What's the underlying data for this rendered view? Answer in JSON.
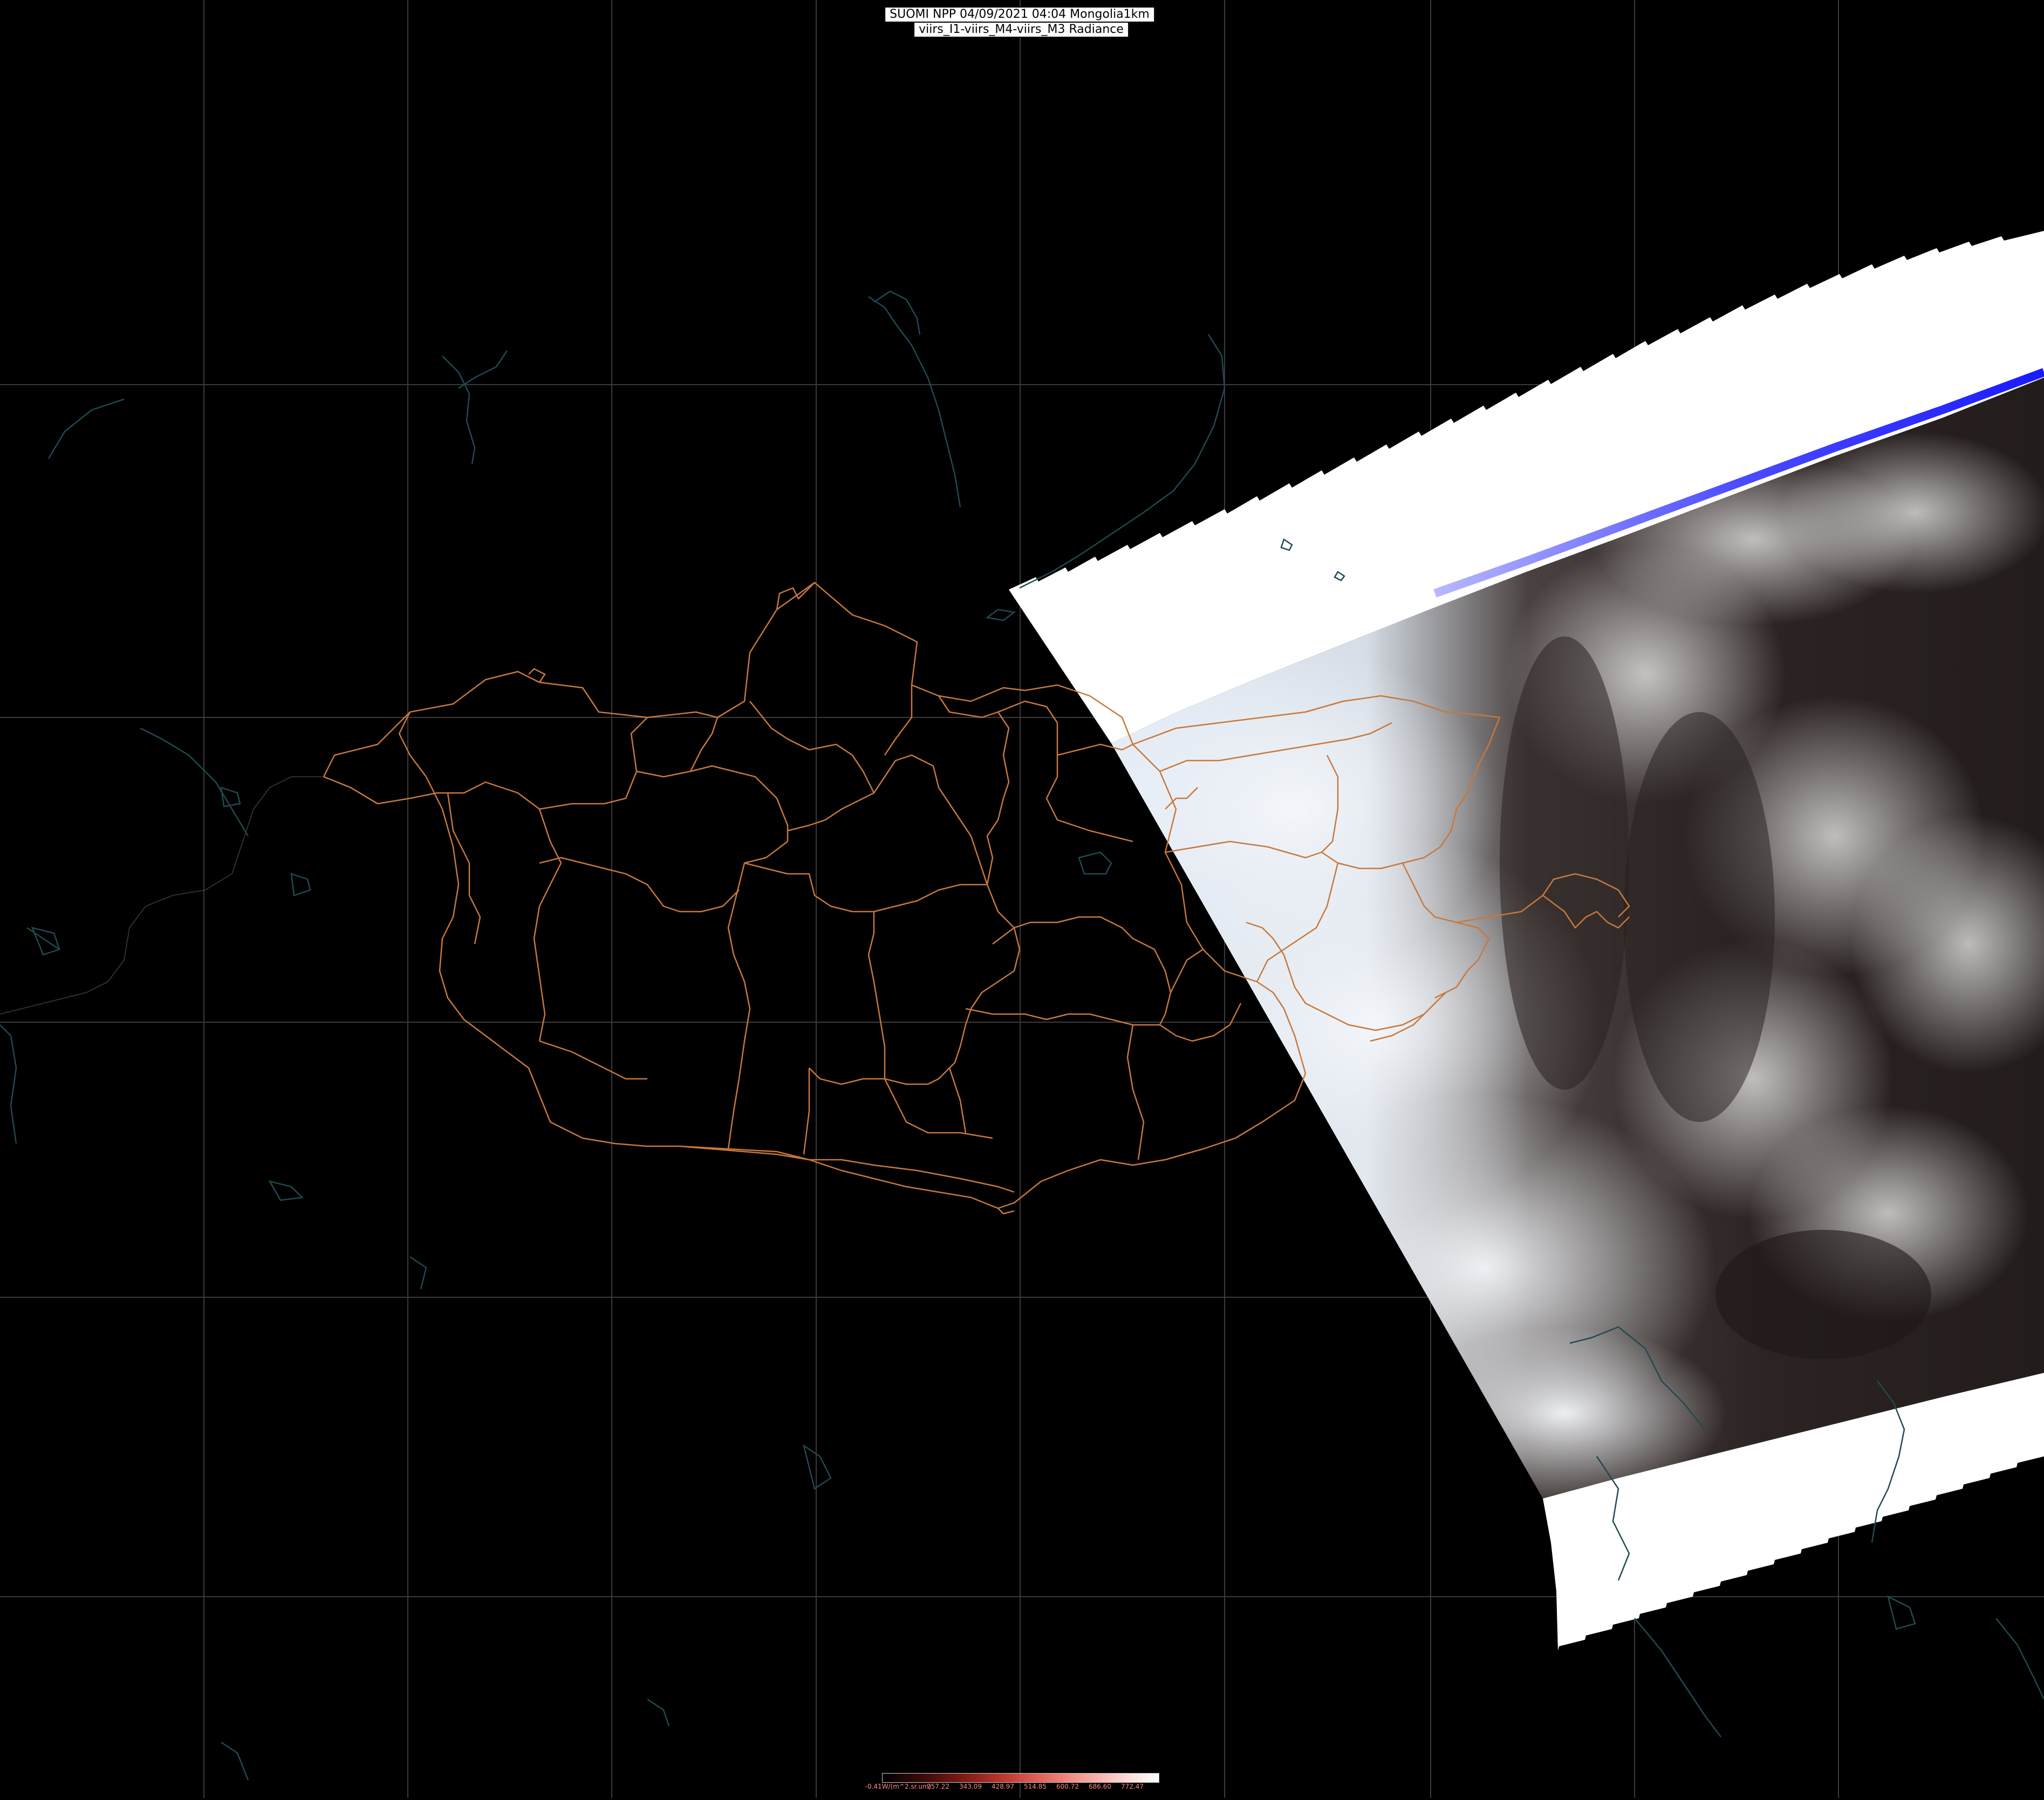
{
  "title": {
    "line1": "SUOMI NPP 04/09/2021 04:04 Mongolia1km",
    "line2": "viirs_I1-viirs_M4-viirs_M3 Radiance"
  },
  "colorbar": {
    "ticks": [
      "-0.41W/(m^2.sr.um)",
      "257.22",
      "343.09",
      "428.97",
      "514.85",
      "600.72",
      "686.60",
      "772.47"
    ],
    "colors": [
      "#000000",
      "#3a0a08",
      "#7a1a14",
      "#b8362c",
      "#e0645a",
      "#f29a92",
      "#fbd0cc",
      "#ffffff"
    ]
  },
  "colors": {
    "background": "#000000",
    "graticule": "#3a3a3a",
    "admin_border": "#c8783a",
    "coastline": "#1f4a52",
    "swath_edge": "#ffffff",
    "swath_limb": "#2b2bff",
    "cloud": "#e8eef6",
    "land_dark": "#2a2220"
  }
}
